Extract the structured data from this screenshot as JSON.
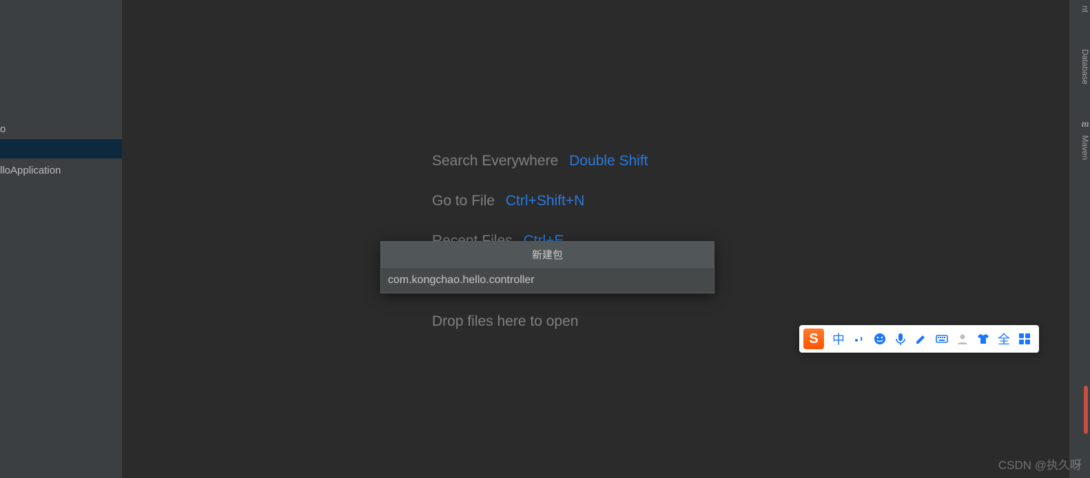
{
  "sidebar": {
    "items": [
      {
        "label": "o"
      },
      {
        "label": ""
      },
      {
        "label": "lloApplication"
      }
    ]
  },
  "hints": {
    "search": {
      "label": "Search Everywhere",
      "shortcut": "Double Shift"
    },
    "goto": {
      "label": "Go to File",
      "shortcut": "Ctrl+Shift+N"
    },
    "recent": {
      "label": "Recent Files",
      "shortcut": "Ctrl+E"
    }
  },
  "drop_text": "Drop files here to open",
  "dialog": {
    "title": "新建包",
    "value": "com.kongchao.hello.controller"
  },
  "right_rail": {
    "top_partial": "nt",
    "database": "Database",
    "maven": "Maven"
  },
  "ime": {
    "logo": "S",
    "lang": "中",
    "full": "全"
  },
  "watermark": "CSDN @执久呀"
}
